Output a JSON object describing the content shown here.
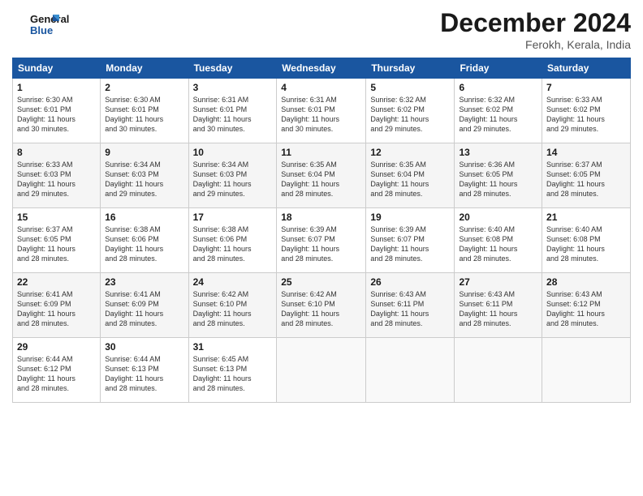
{
  "header": {
    "logo_line1": "General",
    "logo_line2": "Blue",
    "month_title": "December 2024",
    "location": "Ferokh, Kerala, India"
  },
  "days_of_week": [
    "Sunday",
    "Monday",
    "Tuesday",
    "Wednesday",
    "Thursday",
    "Friday",
    "Saturday"
  ],
  "weeks": [
    [
      {
        "day": "1",
        "info": "Sunrise: 6:30 AM\nSunset: 6:01 PM\nDaylight: 11 hours\nand 30 minutes."
      },
      {
        "day": "2",
        "info": "Sunrise: 6:30 AM\nSunset: 6:01 PM\nDaylight: 11 hours\nand 30 minutes."
      },
      {
        "day": "3",
        "info": "Sunrise: 6:31 AM\nSunset: 6:01 PM\nDaylight: 11 hours\nand 30 minutes."
      },
      {
        "day": "4",
        "info": "Sunrise: 6:31 AM\nSunset: 6:01 PM\nDaylight: 11 hours\nand 30 minutes."
      },
      {
        "day": "5",
        "info": "Sunrise: 6:32 AM\nSunset: 6:02 PM\nDaylight: 11 hours\nand 29 minutes."
      },
      {
        "day": "6",
        "info": "Sunrise: 6:32 AM\nSunset: 6:02 PM\nDaylight: 11 hours\nand 29 minutes."
      },
      {
        "day": "7",
        "info": "Sunrise: 6:33 AM\nSunset: 6:02 PM\nDaylight: 11 hours\nand 29 minutes."
      }
    ],
    [
      {
        "day": "8",
        "info": "Sunrise: 6:33 AM\nSunset: 6:03 PM\nDaylight: 11 hours\nand 29 minutes."
      },
      {
        "day": "9",
        "info": "Sunrise: 6:34 AM\nSunset: 6:03 PM\nDaylight: 11 hours\nand 29 minutes."
      },
      {
        "day": "10",
        "info": "Sunrise: 6:34 AM\nSunset: 6:03 PM\nDaylight: 11 hours\nand 29 minutes."
      },
      {
        "day": "11",
        "info": "Sunrise: 6:35 AM\nSunset: 6:04 PM\nDaylight: 11 hours\nand 28 minutes."
      },
      {
        "day": "12",
        "info": "Sunrise: 6:35 AM\nSunset: 6:04 PM\nDaylight: 11 hours\nand 28 minutes."
      },
      {
        "day": "13",
        "info": "Sunrise: 6:36 AM\nSunset: 6:05 PM\nDaylight: 11 hours\nand 28 minutes."
      },
      {
        "day": "14",
        "info": "Sunrise: 6:37 AM\nSunset: 6:05 PM\nDaylight: 11 hours\nand 28 minutes."
      }
    ],
    [
      {
        "day": "15",
        "info": "Sunrise: 6:37 AM\nSunset: 6:05 PM\nDaylight: 11 hours\nand 28 minutes."
      },
      {
        "day": "16",
        "info": "Sunrise: 6:38 AM\nSunset: 6:06 PM\nDaylight: 11 hours\nand 28 minutes."
      },
      {
        "day": "17",
        "info": "Sunrise: 6:38 AM\nSunset: 6:06 PM\nDaylight: 11 hours\nand 28 minutes."
      },
      {
        "day": "18",
        "info": "Sunrise: 6:39 AM\nSunset: 6:07 PM\nDaylight: 11 hours\nand 28 minutes."
      },
      {
        "day": "19",
        "info": "Sunrise: 6:39 AM\nSunset: 6:07 PM\nDaylight: 11 hours\nand 28 minutes."
      },
      {
        "day": "20",
        "info": "Sunrise: 6:40 AM\nSunset: 6:08 PM\nDaylight: 11 hours\nand 28 minutes."
      },
      {
        "day": "21",
        "info": "Sunrise: 6:40 AM\nSunset: 6:08 PM\nDaylight: 11 hours\nand 28 minutes."
      }
    ],
    [
      {
        "day": "22",
        "info": "Sunrise: 6:41 AM\nSunset: 6:09 PM\nDaylight: 11 hours\nand 28 minutes."
      },
      {
        "day": "23",
        "info": "Sunrise: 6:41 AM\nSunset: 6:09 PM\nDaylight: 11 hours\nand 28 minutes."
      },
      {
        "day": "24",
        "info": "Sunrise: 6:42 AM\nSunset: 6:10 PM\nDaylight: 11 hours\nand 28 minutes."
      },
      {
        "day": "25",
        "info": "Sunrise: 6:42 AM\nSunset: 6:10 PM\nDaylight: 11 hours\nand 28 minutes."
      },
      {
        "day": "26",
        "info": "Sunrise: 6:43 AM\nSunset: 6:11 PM\nDaylight: 11 hours\nand 28 minutes."
      },
      {
        "day": "27",
        "info": "Sunrise: 6:43 AM\nSunset: 6:11 PM\nDaylight: 11 hours\nand 28 minutes."
      },
      {
        "day": "28",
        "info": "Sunrise: 6:43 AM\nSunset: 6:12 PM\nDaylight: 11 hours\nand 28 minutes."
      }
    ],
    [
      {
        "day": "29",
        "info": "Sunrise: 6:44 AM\nSunset: 6:12 PM\nDaylight: 11 hours\nand 28 minutes."
      },
      {
        "day": "30",
        "info": "Sunrise: 6:44 AM\nSunset: 6:13 PM\nDaylight: 11 hours\nand 28 minutes."
      },
      {
        "day": "31",
        "info": "Sunrise: 6:45 AM\nSunset: 6:13 PM\nDaylight: 11 hours\nand 28 minutes."
      },
      {
        "day": "",
        "info": ""
      },
      {
        "day": "",
        "info": ""
      },
      {
        "day": "",
        "info": ""
      },
      {
        "day": "",
        "info": ""
      }
    ]
  ]
}
